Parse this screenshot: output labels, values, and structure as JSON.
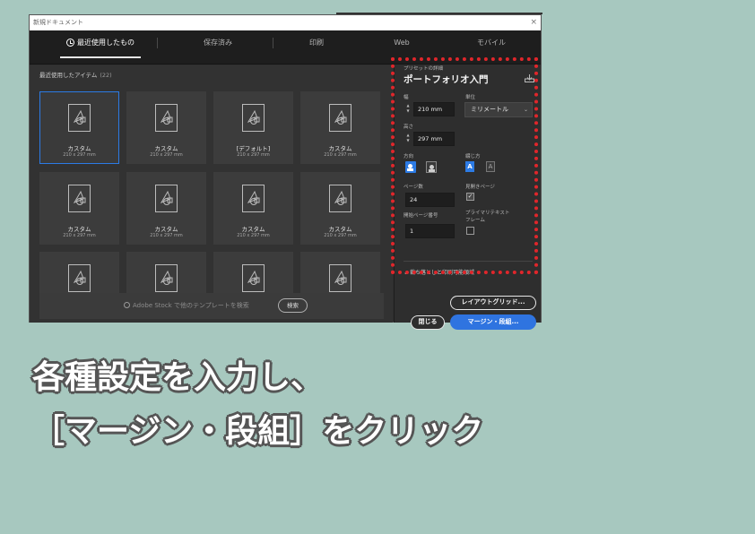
{
  "window": {
    "title": "新規ドキュメント",
    "close_glyph": "×"
  },
  "tabs": [
    {
      "label": "最近使用したもの",
      "active": true
    },
    {
      "label": "保存済み",
      "active": false
    },
    {
      "label": "印刷",
      "active": false
    },
    {
      "label": "Web",
      "active": false
    },
    {
      "label": "モバイル",
      "active": false
    }
  ],
  "recent": {
    "heading": "最近使用したアイテム",
    "count": "(22)",
    "cards": [
      {
        "name": "カスタム",
        "size": "210 x 297 mm",
        "selected": true
      },
      {
        "name": "カスタム",
        "size": "210 x 297 mm"
      },
      {
        "name": "[デフォルト]",
        "size": "210 x 297 mm"
      },
      {
        "name": "カスタム",
        "size": "210 x 297 mm"
      },
      {
        "name": "カスタム",
        "size": "210 x 297 mm"
      },
      {
        "name": "カスタム",
        "size": "210 x 297 mm"
      },
      {
        "name": "カスタム",
        "size": "210 x 297 mm"
      },
      {
        "name": "カスタム",
        "size": "210 x 297 mm"
      },
      {
        "name": "",
        "size": ""
      },
      {
        "name": "",
        "size": ""
      },
      {
        "name": "",
        "size": ""
      },
      {
        "name": "",
        "size": ""
      }
    ]
  },
  "search": {
    "text": "Adobe Stock で他のテンプレートを検索",
    "button": "検索"
  },
  "preset": {
    "section_label": "プリセットの詳細",
    "title": "ポートフォリオ入門",
    "width_label": "幅",
    "width_value": "210 mm",
    "units_label": "単位",
    "units_value": "ミリメートル",
    "height_label": "高さ",
    "height_value": "297 mm",
    "orientation_label": "方向",
    "binding_label": "綴じ方",
    "pages_label": "ページ数",
    "pages_value": "24",
    "facing_label": "見開きページ",
    "facing_checked": true,
    "start_label": "開始ページ番号",
    "start_value": "1",
    "primary_frame_label_1": "プライマリテキスト",
    "primary_frame_label_2": "フレーム",
    "primary_frame_checked": false,
    "bleed_label": "裁ち落としと印刷可能領域"
  },
  "buttons": {
    "layout_grid": "レイアウトグリッド...",
    "close": "閉じる",
    "margins": "マージン・段組..."
  },
  "caption": {
    "line1": "各種設定を入力し、",
    "line2": "［マージン・段組］をクリック"
  },
  "colors": {
    "background": "#a7c8bf",
    "accent": "#2f74e0",
    "highlight": "#e0262b"
  }
}
